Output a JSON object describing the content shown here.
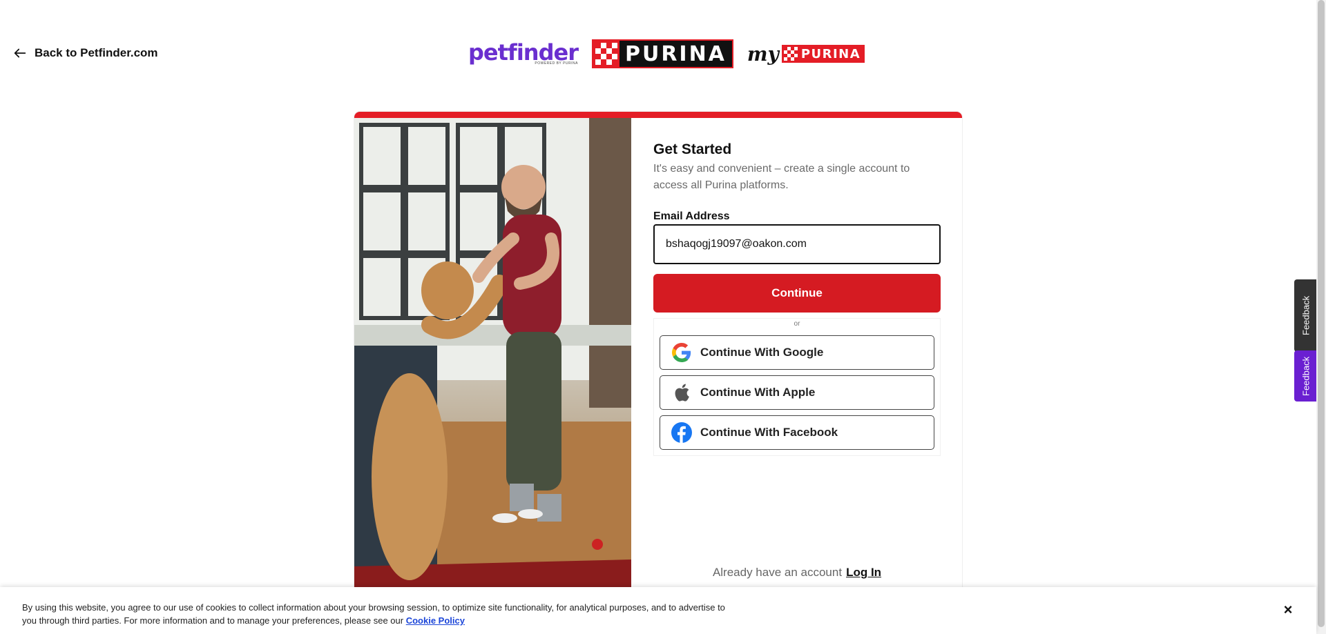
{
  "header": {
    "back_label": "Back to Petfinder.com",
    "logos": {
      "petfinder": "petfinder",
      "petfinder_powered": "POWERED BY PURINA",
      "purina": "PURINA",
      "mypurina_my": "my",
      "mypurina_word": "PURINA"
    }
  },
  "form": {
    "title": "Get Started",
    "subtitle": "It's easy and convenient – create a single account to access all Purina platforms.",
    "email_label": "Email Address",
    "email_value": "bshaqogj19097@oakon.com",
    "continue_label": "Continue",
    "or_label": "or",
    "social": [
      {
        "label": "Continue With Google",
        "icon": "google-icon"
      },
      {
        "label": "Continue With Apple",
        "icon": "apple-icon"
      },
      {
        "label": "Continue With Facebook",
        "icon": "facebook-icon"
      }
    ],
    "already_text": "Already have an account",
    "login_label": "Log In"
  },
  "feedback": {
    "dark_label": "Feedback",
    "purple_label": "Feedback"
  },
  "cookie": {
    "text": "By using this website, you agree to our use of cookies to collect information about your browsing session, to optimize site functionality, for analytical purposes, and to advertise to you through third parties. For more information and to manage your preferences, please see our",
    "link_label": "Cookie Policy",
    "close_label": "×"
  },
  "colors": {
    "brand_red": "#e41d26",
    "button_red": "#d51b22",
    "petfinder_purple": "#6a2fcf",
    "feedback_purple": "#6a1fd1",
    "link_blue": "#1a44d8"
  }
}
